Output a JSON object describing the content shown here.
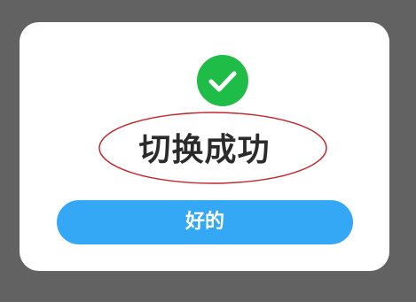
{
  "dialog": {
    "title": "切换成功",
    "ok_button_label": "好的",
    "icon": "check-circle-icon"
  },
  "colors": {
    "overlay": "#626262",
    "dialog_background": "#ffffff",
    "success_green": "#1fbd47",
    "button_blue": "#35a8f5",
    "annotation_red": "#c0282d",
    "title_text": "#2b2b2b"
  }
}
